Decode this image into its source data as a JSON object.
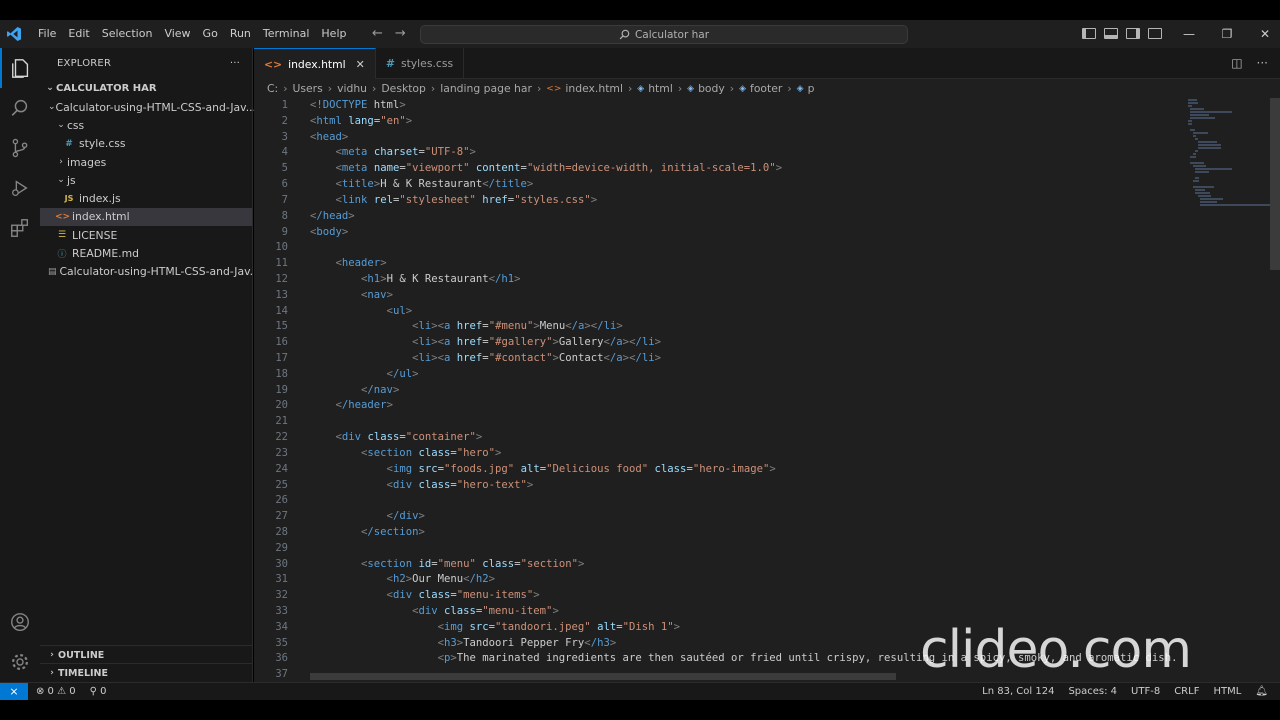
{
  "titlebar": {
    "menus": [
      "File",
      "Edit",
      "Selection",
      "View",
      "Go",
      "Run",
      "Terminal",
      "Help"
    ],
    "search": "Calculator har",
    "window_controls": [
      "—",
      "❐",
      "✕"
    ]
  },
  "explorer": {
    "header": "EXPLORER",
    "more": "···",
    "root": "CALCULATOR HAR",
    "tree": [
      {
        "label": "Calculator-using-HTML-CSS-and-Jav...",
        "kind": "folder-open",
        "depth": 1
      },
      {
        "label": "css",
        "kind": "folder-open",
        "depth": 2
      },
      {
        "label": "style.css",
        "kind": "css",
        "depth": 3
      },
      {
        "label": "images",
        "kind": "folder-closed",
        "depth": 2
      },
      {
        "label": "js",
        "kind": "folder-open",
        "depth": 2
      },
      {
        "label": "index.js",
        "kind": "js",
        "depth": 3
      },
      {
        "label": "index.html",
        "kind": "html",
        "depth": 2,
        "selected": true
      },
      {
        "label": "LICENSE",
        "kind": "license",
        "depth": 2
      },
      {
        "label": "README.md",
        "kind": "info",
        "depth": 2
      },
      {
        "label": "Calculator-using-HTML-CSS-and-Jav...",
        "kind": "file",
        "depth": 1
      }
    ],
    "outline": "OUTLINE",
    "timeline": "TIMELINE"
  },
  "tabs": [
    {
      "label": "index.html",
      "active": true,
      "close": "✕"
    },
    {
      "label": "styles.css",
      "active": false
    }
  ],
  "breadcrumb": [
    "C:",
    "Users",
    "vidhu",
    "Desktop",
    "landing page har",
    "index.html",
    "html",
    "body",
    "footer",
    "p"
  ],
  "editor": {
    "line_start": 1,
    "lines": [
      "<!DOCTYPE html>",
      "<html lang=\"en\">",
      "<head>",
      "    <meta charset=\"UTF-8\">",
      "    <meta name=\"viewport\" content=\"width=device-width, initial-scale=1.0\">",
      "    <title>H & K Restaurant</title>",
      "    <link rel=\"stylesheet\" href=\"styles.css\">",
      "</head>",
      "<body>",
      "",
      "    <header>",
      "        <h1>H & K Restaurant</h1>",
      "        <nav>",
      "            <ul>",
      "                <li><a href=\"#menu\">Menu</a></li>",
      "                <li><a href=\"#gallery\">Gallery</a></li>",
      "                <li><a href=\"#contact\">Contact</a></li>",
      "            </ul>",
      "        </nav>",
      "    </header>",
      "",
      "    <div class=\"container\">",
      "        <section class=\"hero\">",
      "            <img src=\"foods.jpg\" alt=\"Delicious food\" class=\"hero-image\">",
      "            <div class=\"hero-text\">",
      "",
      "            </div>",
      "        </section>",
      "",
      "        <section id=\"menu\" class=\"section\">",
      "            <h2>Our Menu</h2>",
      "            <div class=\"menu-items\">",
      "                <div class=\"menu-item\">",
      "                    <img src=\"tandoori.jpeg\" alt=\"Dish 1\">",
      "                    <h3>Tandoori Pepper Fry</h3>",
      "                    <p>The marinated ingredients are then sautéed or fried until crispy, resulting in a spicy, smoky, and aromatic dish.",
      ""
    ]
  },
  "watermark": "clideo.com",
  "statusbar": {
    "remote": "⨯",
    "errors": "⊗ 0 ⚠ 0",
    "ports": "⚲ 0",
    "position": "Ln 83, Col 124",
    "spaces": "Spaces: 4",
    "encoding": "UTF-8",
    "eol": "CRLF",
    "language": "HTML",
    "bell": "🔔"
  }
}
